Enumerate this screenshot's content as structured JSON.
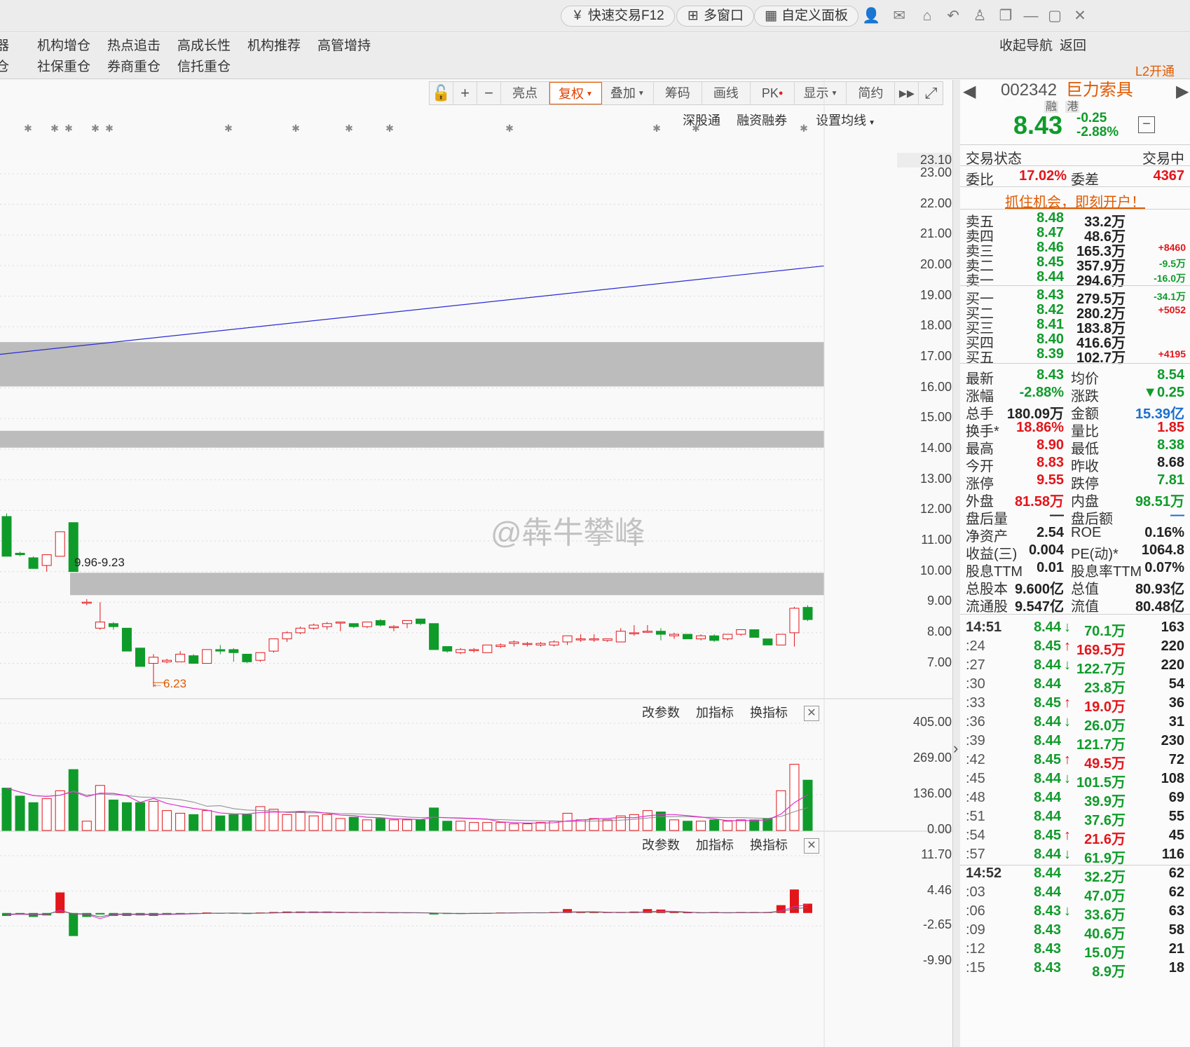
{
  "topbar": {
    "quick_trade": "快速交易F12",
    "multi_window": "多窗口",
    "custom_panel": "自定义面板"
  },
  "menu": {
    "row1": [
      "机构增仓",
      "热点追击",
      "高成长性",
      "机构推荐",
      "高管增持"
    ],
    "row2": [
      "社保重仓",
      "券商重仓",
      "信托重仓"
    ],
    "row1_left_cut": "器",
    "row2_left_cut": "仓",
    "collapse_nav": "收起导航",
    "back": "返回",
    "l2_open": "L2开通"
  },
  "toolbar": {
    "items": [
      "亮点",
      "复权",
      "叠加",
      "筹码",
      "画线",
      "PK",
      "显示",
      "简约"
    ],
    "active": "复权"
  },
  "subtools": [
    "深股通",
    "融资融券",
    "设置均线"
  ],
  "price_axis": [
    "23.10",
    "23.00",
    "22.00",
    "21.00",
    "20.00",
    "19.00",
    "18.00",
    "17.00",
    "16.00",
    "15.00",
    "14.00",
    "13.00",
    "12.00",
    "11.00",
    "10.00",
    "9.00",
    "8.00",
    "7.00"
  ],
  "annotations": {
    "gap_label": "9.96-9.23",
    "low_label": "6.23"
  },
  "watermark": "@犇牛攀峰",
  "volume_panel": {
    "tools": [
      "改参数",
      "加指标",
      "换指标"
    ],
    "axis": [
      "405.00",
      "269.00",
      "136.00",
      "0.00"
    ]
  },
  "macd_panel": {
    "tools": [
      "改参数",
      "加指标",
      "换指标"
    ],
    "axis": [
      "11.70",
      "4.46",
      "-2.65",
      "-9.90"
    ]
  },
  "chart_data": {
    "type": "candlestick",
    "ylim": [
      6.0,
      23.1
    ],
    "candles": [
      [
        11.8,
        11.9,
        10.6,
        10.5
      ],
      [
        10.6,
        10.65,
        10.5,
        10.55
      ],
      [
        10.45,
        10.5,
        10.1,
        10.1
      ],
      [
        10.2,
        10.55,
        10.0,
        10.55
      ],
      [
        10.5,
        11.3,
        10.5,
        11.3
      ],
      [
        11.6,
        11.6,
        10.0,
        10.0
      ],
      [
        9.0,
        9.1,
        8.9,
        9.0
      ],
      [
        8.15,
        9.0,
        8.1,
        8.35
      ],
      [
        8.3,
        8.35,
        8.1,
        8.2
      ],
      [
        8.15,
        8.15,
        7.4,
        7.4
      ],
      [
        7.5,
        7.5,
        6.9,
        6.9
      ],
      [
        7.0,
        7.3,
        6.23,
        7.2
      ],
      [
        7.05,
        7.15,
        7.0,
        7.1
      ],
      [
        7.05,
        7.4,
        7.05,
        7.3
      ],
      [
        7.25,
        7.3,
        7.0,
        7.0
      ],
      [
        7.0,
        7.45,
        7.0,
        7.45
      ],
      [
        7.45,
        7.6,
        7.3,
        7.4
      ],
      [
        7.45,
        7.5,
        7.05,
        7.35
      ],
      [
        7.3,
        7.3,
        7.0,
        7.05
      ],
      [
        7.1,
        7.35,
        7.05,
        7.35
      ],
      [
        7.4,
        7.8,
        7.35,
        7.8
      ],
      [
        7.8,
        8.05,
        7.7,
        8.0
      ],
      [
        8.0,
        8.2,
        7.95,
        8.15
      ],
      [
        8.15,
        8.3,
        8.1,
        8.25
      ],
      [
        8.2,
        8.35,
        8.1,
        8.3
      ],
      [
        8.35,
        8.35,
        8.05,
        8.35
      ],
      [
        8.3,
        8.3,
        8.15,
        8.2
      ],
      [
        8.2,
        8.35,
        8.15,
        8.35
      ],
      [
        8.4,
        8.45,
        8.2,
        8.25
      ],
      [
        8.2,
        8.25,
        8.05,
        8.2
      ],
      [
        8.3,
        8.4,
        8.15,
        8.4
      ],
      [
        8.45,
        8.45,
        8.25,
        8.3
      ],
      [
        8.3,
        8.3,
        7.45,
        7.45
      ],
      [
        7.55,
        7.55,
        7.35,
        7.4
      ],
      [
        7.35,
        7.5,
        7.3,
        7.45
      ],
      [
        7.45,
        7.5,
        7.35,
        7.45
      ],
      [
        7.35,
        7.6,
        7.35,
        7.6
      ],
      [
        7.55,
        7.65,
        7.5,
        7.6
      ],
      [
        7.65,
        7.75,
        7.55,
        7.7
      ],
      [
        7.65,
        7.7,
        7.55,
        7.65
      ],
      [
        7.6,
        7.7,
        7.55,
        7.65
      ],
      [
        7.6,
        7.75,
        7.55,
        7.7
      ],
      [
        7.7,
        7.9,
        7.6,
        7.9
      ],
      [
        7.8,
        7.95,
        7.7,
        7.8
      ],
      [
        7.8,
        7.95,
        7.7,
        7.8
      ],
      [
        7.75,
        7.8,
        7.7,
        7.8
      ],
      [
        7.7,
        8.15,
        7.7,
        8.05
      ],
      [
        8.0,
        8.25,
        7.9,
        8.0
      ],
      [
        8.05,
        8.25,
        8.0,
        8.05
      ],
      [
        8.05,
        8.15,
        7.75,
        7.95
      ],
      [
        7.9,
        8.0,
        7.8,
        7.95
      ],
      [
        7.95,
        7.95,
        7.8,
        7.8
      ],
      [
        7.8,
        7.95,
        7.75,
        7.9
      ],
      [
        7.9,
        7.95,
        7.7,
        7.75
      ],
      [
        7.8,
        7.95,
        7.75,
        7.95
      ],
      [
        7.95,
        8.1,
        7.9,
        8.1
      ],
      [
        8.1,
        8.1,
        7.85,
        7.85
      ],
      [
        7.8,
        7.8,
        7.6,
        7.6
      ],
      [
        7.6,
        7.95,
        7.6,
        7.95
      ],
      [
        8.0,
        8.85,
        7.55,
        8.8
      ],
      [
        8.83,
        8.9,
        8.38,
        8.43
      ]
    ],
    "ma_line_endpoints": [
      17.1,
      19.99
    ],
    "gaps": [
      [
        16.05,
        17.5
      ],
      [
        14.05,
        14.6
      ],
      [
        9.23,
        9.96
      ]
    ],
    "volume_ylim": [
      0,
      405
    ],
    "volume": [
      160,
      130,
      105,
      120,
      150,
      230,
      35,
      170,
      115,
      105,
      105,
      110,
      75,
      65,
      60,
      75,
      55,
      60,
      60,
      90,
      80,
      60,
      70,
      55,
      60,
      45,
      50,
      40,
      45,
      40,
      40,
      40,
      85,
      35,
      35,
      30,
      30,
      30,
      25,
      25,
      30,
      35,
      65,
      40,
      45,
      40,
      55,
      60,
      75,
      70,
      40,
      35,
      35,
      40,
      35,
      40,
      40,
      45,
      150,
      250,
      190
    ],
    "macd_ylim": [
      -9.9,
      11.7
    ],
    "macd": [
      -0.6,
      -0.3,
      -0.8,
      -0.5,
      4.2,
      -4.7,
      -0.8,
      -0.3,
      -0.6,
      -0.6,
      -0.5,
      -0.6,
      -0.4,
      -0.3,
      -0.2,
      0.1,
      -0.1,
      -0.1,
      -0.2,
      0.1,
      0.2,
      0.3,
      0.3,
      0.3,
      0.3,
      0.2,
      0.2,
      0.2,
      0.2,
      0.1,
      0.1,
      0.1,
      -0.3,
      -0.2,
      -0.2,
      -0.1,
      -0.1,
      0.1,
      0.1,
      0.1,
      0.1,
      0.2,
      0.8,
      0.3,
      0.3,
      0.2,
      0.2,
      0.3,
      0.8,
      0.7,
      0.2,
      0.1,
      0.1,
      0.2,
      0.1,
      0.2,
      0.2,
      0.2,
      1.6,
      4.8,
      1.9
    ]
  },
  "stock": {
    "code": "002342",
    "name": "巨力索具",
    "tags": [
      "融",
      "港"
    ],
    "price": "8.43",
    "change": "-0.25",
    "change_pct": "-2.88%",
    "status_label": "交易状态",
    "status_value": "交易中",
    "ratio_label": "委比",
    "ratio_value": "17.02%",
    "diff_label": "委差",
    "diff_value": "4367",
    "promo": "抓住机会，即刻开户！"
  },
  "order_book": {
    "asks": [
      {
        "label": "卖五",
        "price": "8.48",
        "vol": "33.2万",
        "chg": ""
      },
      {
        "label": "卖四",
        "price": "8.47",
        "vol": "48.6万",
        "chg": ""
      },
      {
        "label": "卖三",
        "price": "8.46",
        "vol": "165.3万",
        "chg": "+8460"
      },
      {
        "label": "卖二",
        "price": "8.45",
        "vol": "357.9万",
        "chg": "-9.5万"
      },
      {
        "label": "卖一",
        "price": "8.44",
        "vol": "294.6万",
        "chg": "-16.0万"
      }
    ],
    "bids": [
      {
        "label": "买一",
        "price": "8.43",
        "vol": "279.5万",
        "chg": "-34.1万"
      },
      {
        "label": "买二",
        "price": "8.42",
        "vol": "280.2万",
        "chg": "+5052"
      },
      {
        "label": "买三",
        "price": "8.41",
        "vol": "183.8万",
        "chg": ""
      },
      {
        "label": "买四",
        "price": "8.40",
        "vol": "416.6万",
        "chg": ""
      },
      {
        "label": "买五",
        "price": "8.39",
        "vol": "102.7万",
        "chg": "+4195"
      }
    ]
  },
  "quote": [
    [
      "最新",
      "8.43",
      "均价",
      "8.54"
    ],
    [
      "涨幅",
      "-2.88%",
      "涨跌",
      "▼0.25"
    ],
    [
      "总手",
      "180.09万",
      "金额",
      "15.39亿"
    ],
    [
      "换手*",
      "18.86%",
      "量比",
      "1.85"
    ],
    [
      "最高",
      "8.90",
      "最低",
      "8.38"
    ],
    [
      "今开",
      "8.83",
      "昨收",
      "8.68"
    ],
    [
      "涨停",
      "9.55",
      "跌停",
      "7.81"
    ],
    [
      "外盘",
      "81.58万",
      "内盘",
      "98.51万"
    ],
    [
      "盘后量",
      "—",
      "盘后额",
      "—"
    ],
    [
      "净资产",
      "2.54",
      "ROE",
      "0.16%"
    ],
    [
      "收益(三)",
      "0.004",
      "PE(动)*",
      "1064.8"
    ],
    [
      "股息TTM",
      "0.01",
      "股息率TTM",
      "0.07%"
    ],
    [
      "总股本",
      "9.600亿",
      "总值",
      "80.93亿"
    ],
    [
      "流通股",
      "9.547亿",
      "流值",
      "80.48亿"
    ]
  ],
  "ticks": [
    [
      "14:51",
      "8.44",
      "down",
      "70.1万",
      "163"
    ],
    [
      ":24",
      "8.45",
      "up",
      "169.5万",
      "220"
    ],
    [
      ":27",
      "8.44",
      "down",
      "122.7万",
      "220"
    ],
    [
      ":30",
      "8.44",
      "",
      "23.8万",
      "54"
    ],
    [
      ":33",
      "8.45",
      "up",
      "19.0万",
      "36"
    ],
    [
      ":36",
      "8.44",
      "down",
      "26.0万",
      "31"
    ],
    [
      ":39",
      "8.44",
      "",
      "121.7万",
      "230"
    ],
    [
      ":42",
      "8.45",
      "up",
      "49.5万",
      "72"
    ],
    [
      ":45",
      "8.44",
      "down",
      "101.5万",
      "108"
    ],
    [
      ":48",
      "8.44",
      "",
      "39.9万",
      "69"
    ],
    [
      ":51",
      "8.44",
      "",
      "37.6万",
      "55"
    ],
    [
      ":54",
      "8.45",
      "up",
      "21.6万",
      "45"
    ],
    [
      ":57",
      "8.44",
      "down",
      "61.9万",
      "116"
    ],
    [
      "14:52",
      "8.44",
      "",
      "32.2万",
      "62"
    ],
    [
      ":03",
      "8.44",
      "",
      "47.0万",
      "62"
    ],
    [
      ":06",
      "8.43",
      "down",
      "33.6万",
      "63"
    ],
    [
      ":09",
      "8.43",
      "",
      "40.6万",
      "58"
    ],
    [
      ":12",
      "8.43",
      "",
      "15.0万",
      "21"
    ],
    [
      ":15",
      "8.43",
      "",
      "8.9万",
      "18"
    ]
  ],
  "colors": {
    "up": "#e2151a",
    "down": "#0f9b2a",
    "ma": "#2b2bd6",
    "accent": "#e05a00"
  }
}
